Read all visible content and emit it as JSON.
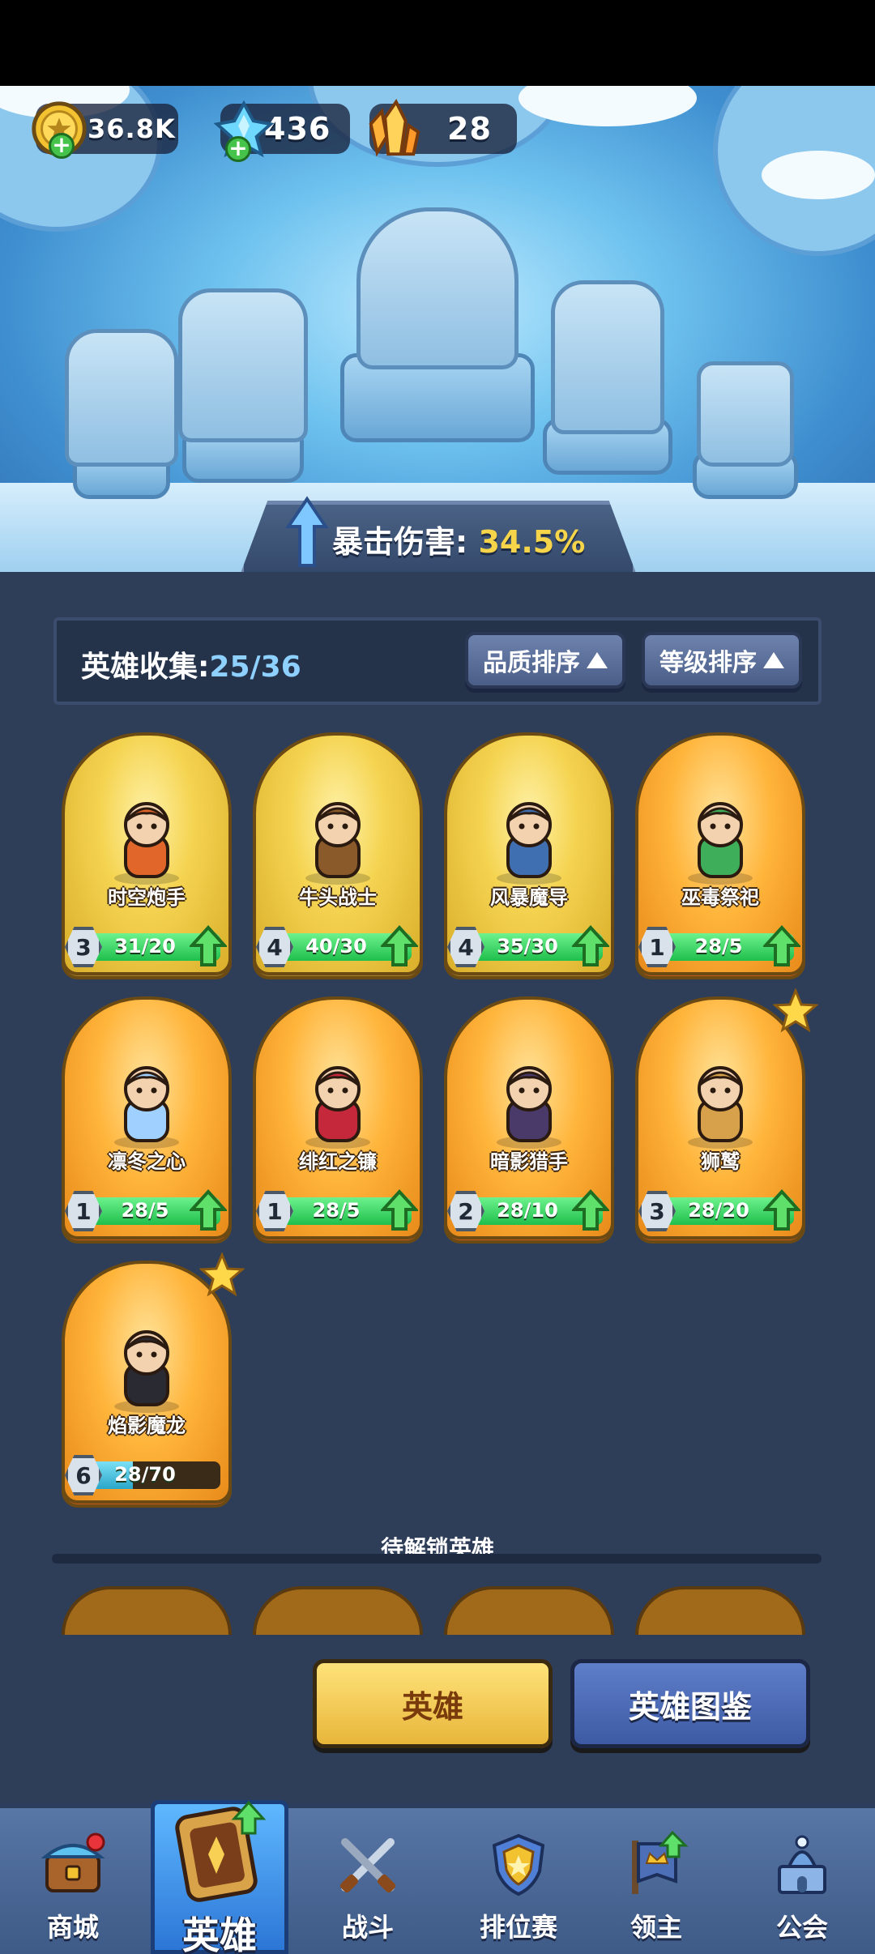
{
  "currencies": [
    {
      "name": "gold-coin-icon",
      "value": "36.8K"
    },
    {
      "name": "blue-crystal-icon",
      "value": "436"
    },
    {
      "name": "orange-crystal-icon",
      "value": "28"
    }
  ],
  "bonus": {
    "label": "暴击伤害:",
    "value": "34.5%"
  },
  "collection": {
    "label": "英雄收集:",
    "value": "25/36"
  },
  "sort": {
    "quality": "品质排序",
    "level": "等级排序"
  },
  "heroes": [
    {
      "name": "时空炮手",
      "level": "3",
      "progress": "31/20",
      "ready": true,
      "rarity": "gold"
    },
    {
      "name": "牛头战士",
      "level": "4",
      "progress": "40/30",
      "ready": true,
      "rarity": "gold"
    },
    {
      "name": "风暴魔导",
      "level": "4",
      "progress": "35/30",
      "ready": true,
      "rarity": "gold"
    },
    {
      "name": "巫毒祭祀",
      "level": "1",
      "progress": "28/5",
      "ready": true,
      "rarity": "orange"
    },
    {
      "name": "凛冬之心",
      "level": "1",
      "progress": "28/5",
      "ready": true,
      "rarity": "orange"
    },
    {
      "name": "绯红之镰",
      "level": "1",
      "progress": "28/5",
      "ready": true,
      "rarity": "orange"
    },
    {
      "name": "暗影猎手",
      "level": "2",
      "progress": "28/10",
      "ready": true,
      "rarity": "orange"
    },
    {
      "name": "狮鹫",
      "level": "3",
      "progress": "28/20",
      "ready": true,
      "rarity": "orange",
      "starred": true
    },
    {
      "name": "焰影魔龙",
      "level": "6",
      "progress": "28/70",
      "fill": 0.4,
      "ready": false,
      "rarity": "orange",
      "starred": true
    }
  ],
  "locked_title": "待解锁英雄",
  "buttons": {
    "hero": "英雄",
    "codex": "英雄图鉴"
  },
  "nav": {
    "shop": "商城",
    "hero": "英雄",
    "battle": "战斗",
    "ranked": "排位赛",
    "lord": "领主",
    "guild": "公会"
  },
  "colors": {
    "accent_yellow": "#f7d54a",
    "panel_bg": "#2e3d58",
    "nav_bg": "#4a6896",
    "progress_green": "#1fbf4c",
    "progress_blue": "#2aa6c9"
  }
}
